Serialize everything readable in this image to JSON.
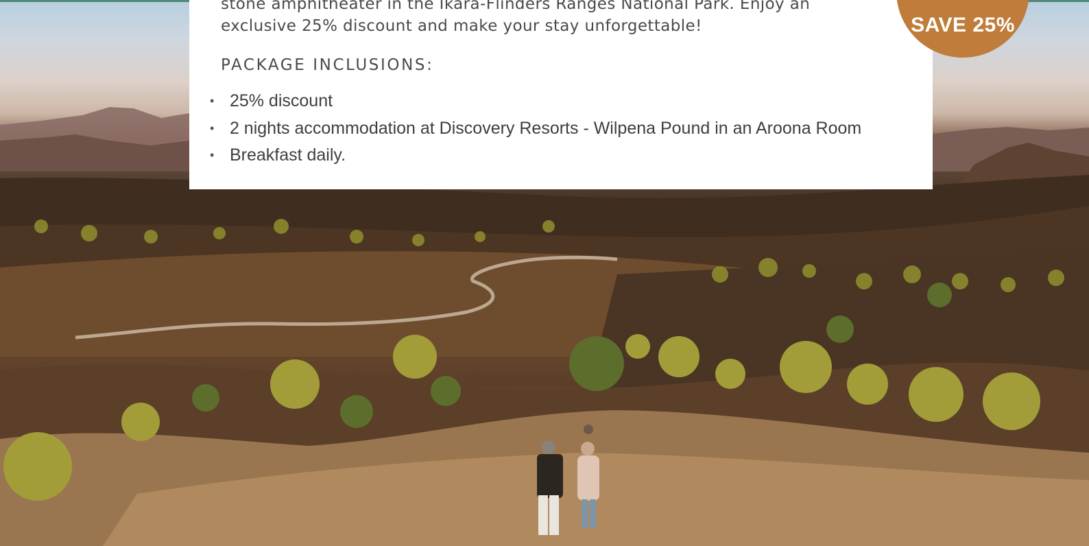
{
  "card": {
    "description": "stone amphitheater in the Ikara-Flinders Ranges National Park. Enjoy an exclusive 25% discount and make your stay unforgettable!",
    "inclusions_heading": "PACKAGE INCLUSIONS:",
    "inclusions": [
      {
        "text": "25% discount"
      },
      {
        "text": "2 nights accommodation at Discovery Resorts - Wilpena Pound in an Aroona Room"
      },
      {
        "text": "Breakfast daily."
      }
    ],
    "bullet": "•"
  },
  "badge": {
    "label": "SAVE 25%"
  },
  "colors": {
    "accent_bar": "#4e8b78",
    "badge": "#bf7c3a",
    "card_bg": "#ffffff",
    "text": "#4a4a4a"
  }
}
